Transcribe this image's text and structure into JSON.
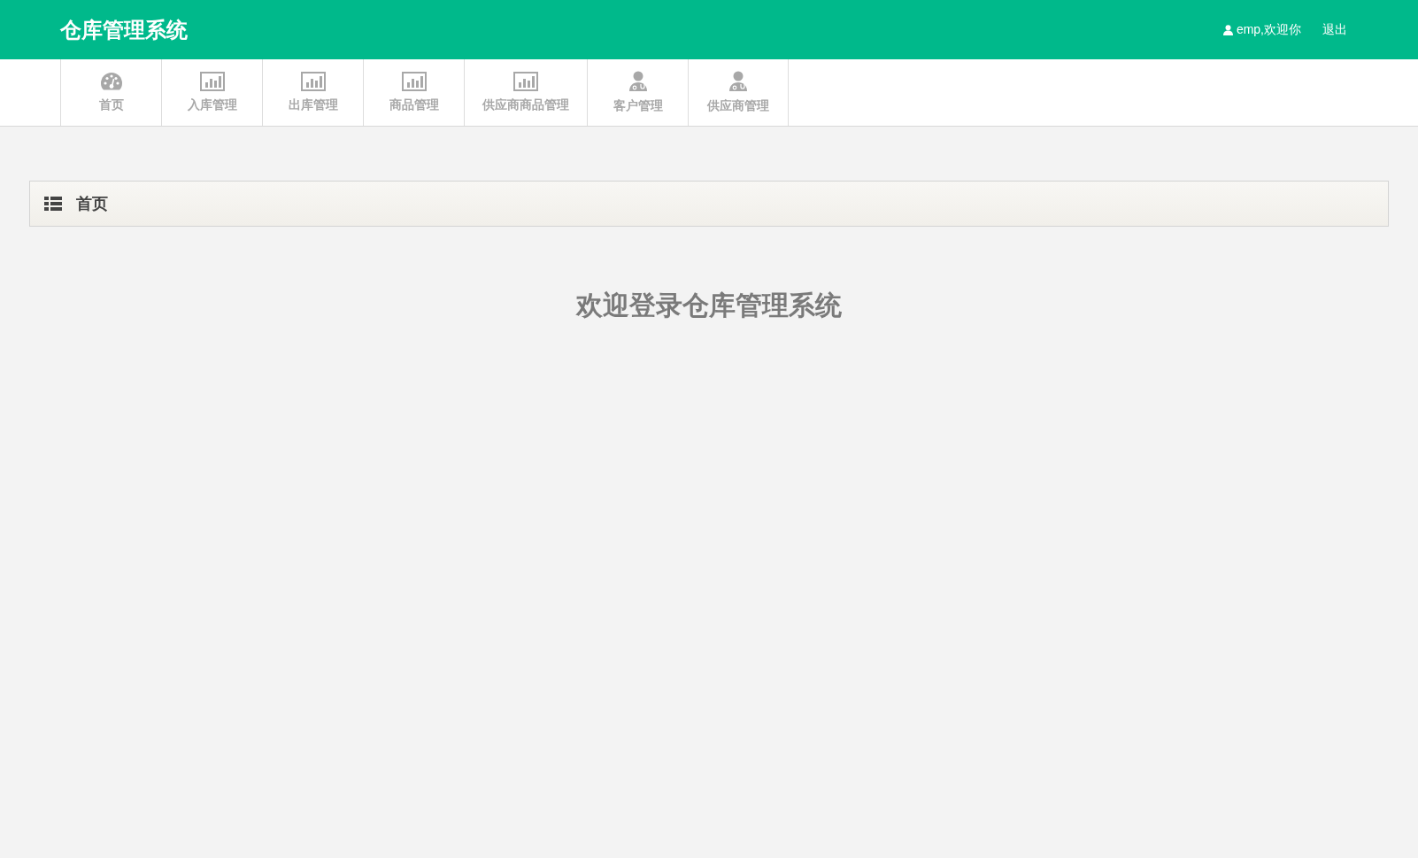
{
  "header": {
    "title": "仓库管理系统",
    "user": "emp,欢迎你",
    "logout": "退出"
  },
  "nav": [
    {
      "label": "首页",
      "kind": "dashboard"
    },
    {
      "label": "入库管理",
      "kind": "chart"
    },
    {
      "label": "出库管理",
      "kind": "chart"
    },
    {
      "label": "商品管理",
      "kind": "chart"
    },
    {
      "label": "供应商商品管理",
      "kind": "chart"
    },
    {
      "label": "客户管理",
      "kind": "person"
    },
    {
      "label": "供应商管理",
      "kind": "person"
    }
  ],
  "breadcrumb": "首页",
  "welcome": "欢迎登录仓库管理系统"
}
